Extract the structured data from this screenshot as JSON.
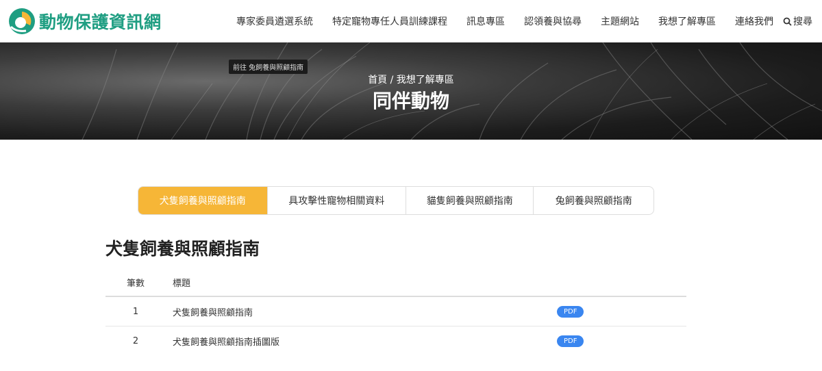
{
  "site": {
    "name": "動物保護資訊網",
    "colors": {
      "brand_green": "#1f9e82",
      "brand_yellow": "#f6b637",
      "pdf_blue": "#3a86f0"
    }
  },
  "nav": {
    "items": [
      "專家委員遴選系統",
      "特定寵物專任人員訓練課程",
      "訊息專區",
      "認領養與協尋",
      "主題網站",
      "我想了解專區",
      "連絡我們"
    ],
    "search_label": "搜尋",
    "search_icon": "search-icon"
  },
  "banner": {
    "goto_tag": "前往 兔飼養與照顧指南",
    "breadcrumb": "首頁 / 我想了解專區",
    "title": "同伴動物"
  },
  "tabs": [
    {
      "label": "犬隻飼養與照顧指南",
      "active": true
    },
    {
      "label": "具攻擊性寵物相關資料",
      "active": false
    },
    {
      "label": "貓隻飼養與照顧指南",
      "active": false
    },
    {
      "label": "兔飼養與照顧指南",
      "active": false
    }
  ],
  "section": {
    "title": "犬隻飼養與照顧指南",
    "columns": [
      "筆數",
      "標題"
    ],
    "rows": [
      {
        "num": "1",
        "title": "犬隻飼養與照顧指南",
        "file": "PDF"
      },
      {
        "num": "2",
        "title": "犬隻飼養與照顧指南插圖版",
        "file": "PDF"
      }
    ]
  }
}
